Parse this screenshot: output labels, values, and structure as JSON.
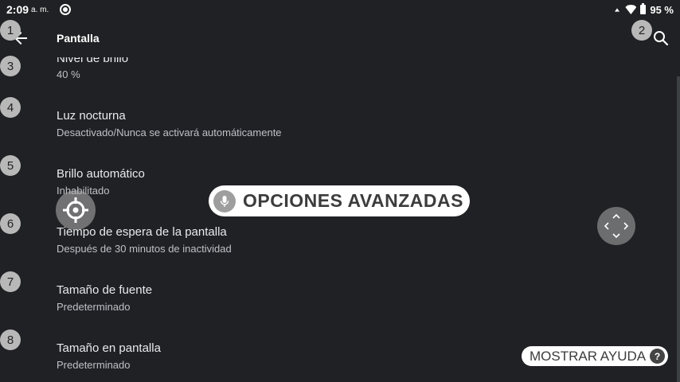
{
  "status_bar": {
    "time": "2:09",
    "ampm": "a. m.",
    "battery": "95 %"
  },
  "app_bar": {
    "title": "Pantalla",
    "back_icon": "arrow-left-icon",
    "search_icon": "search-icon"
  },
  "settings": [
    {
      "title": "Nivel de brillo",
      "summary": "40 %"
    },
    {
      "title": "Luz nocturna",
      "summary": "Desactivado/Nunca se activará automáticamente"
    },
    {
      "title": "Brillo automático",
      "summary": "Inhabilitado"
    },
    {
      "title": "Tiempo de espera de la pantalla",
      "summary": "Después de 30 minutos de inactividad"
    },
    {
      "title": "Tamaño de fuente",
      "summary": "Predeterminado"
    },
    {
      "title": "Tamaño en pantalla",
      "summary": "Predeterminado"
    }
  ],
  "badges": [
    "1",
    "2",
    "3",
    "4",
    "5",
    "6",
    "7",
    "8"
  ],
  "voice_overlay": {
    "text": "OPCIONES AVANZADAS"
  },
  "help_button": {
    "label": "MOSTRAR AYUDA",
    "icon": "?"
  }
}
